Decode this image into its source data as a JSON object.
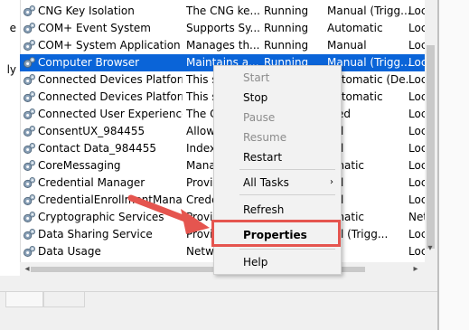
{
  "left_pane": {
    "fragments": [
      "e",
      "ly"
    ]
  },
  "services": {
    "rows": [
      {
        "name": "CNG Key Isolation",
        "description": "The CNG ke...",
        "status": "Running",
        "startup": "Manual (Trigg...",
        "logon": "Loc"
      },
      {
        "name": "COM+ Event System",
        "description": "Supports Sy...",
        "status": "Running",
        "startup": "Automatic",
        "logon": "Loc"
      },
      {
        "name": "COM+ System Application",
        "description": "Manages th...",
        "status": "Running",
        "startup": "Manual",
        "logon": "Loc"
      },
      {
        "name": "Computer Browser",
        "description": "Maintains a...",
        "status": "Running",
        "startup": "Manual (Trigg...",
        "logon": "Loc"
      },
      {
        "name": "Connected Devices Platform ...",
        "description": "This s",
        "status": "",
        "startup": "Automatic (De...",
        "logon": "Loc"
      },
      {
        "name": "Connected Devices Platform ...",
        "description": "This s",
        "status": "",
        "startup": "Automatic",
        "logon": "Loc"
      },
      {
        "name": "Connected User Experiences ...",
        "description": "The C",
        "status": "",
        "startup": "bled",
        "logon": "Loc"
      },
      {
        "name": "ConsentUX_984455",
        "description": "Allow",
        "status": "",
        "startup": "ual",
        "logon": "Loc"
      },
      {
        "name": "Contact Data_984455",
        "description": "Index",
        "status": "",
        "startup": "ual",
        "logon": "Loc"
      },
      {
        "name": "CoreMessaging",
        "description": "Mana",
        "status": "",
        "startup": "omatic",
        "logon": "Loc"
      },
      {
        "name": "Credential Manager",
        "description": "Provi",
        "status": "",
        "startup": "ual",
        "logon": "Loc"
      },
      {
        "name": "CredentialEnrollmentManag...",
        "description": "Crede",
        "status": "",
        "startup": "ual",
        "logon": "Loc"
      },
      {
        "name": "Cryptographic Services",
        "description": "Provi",
        "status": "",
        "startup": "omatic",
        "logon": "Net"
      },
      {
        "name": "Data Sharing Service",
        "description": "Provi",
        "status": "",
        "startup": "ual (Trigg...",
        "logon": "Loc"
      },
      {
        "name": "Data Usage",
        "description": "Netw",
        "status": "",
        "startup": "",
        "logon": "Loc"
      }
    ]
  },
  "context_menu": {
    "items": [
      {
        "label": "Start",
        "disabled": true
      },
      {
        "label": "Stop",
        "disabled": false
      },
      {
        "label": "Pause",
        "disabled": true
      },
      {
        "label": "Resume",
        "disabled": true
      },
      {
        "label": "Restart",
        "disabled": false
      },
      {
        "label": "All Tasks",
        "disabled": false,
        "submenu_glyph": "›"
      },
      {
        "label": "Refresh",
        "disabled": false
      },
      {
        "label": "Properties",
        "disabled": false
      },
      {
        "label": "Help",
        "disabled": false
      }
    ]
  },
  "icons": {
    "service_row": "gear-icon",
    "scroll_left": "◂",
    "scroll_right": "▸",
    "scroll_down": "▾"
  },
  "colors": {
    "selection": "#0a64d8",
    "callout": "#e5554f"
  }
}
